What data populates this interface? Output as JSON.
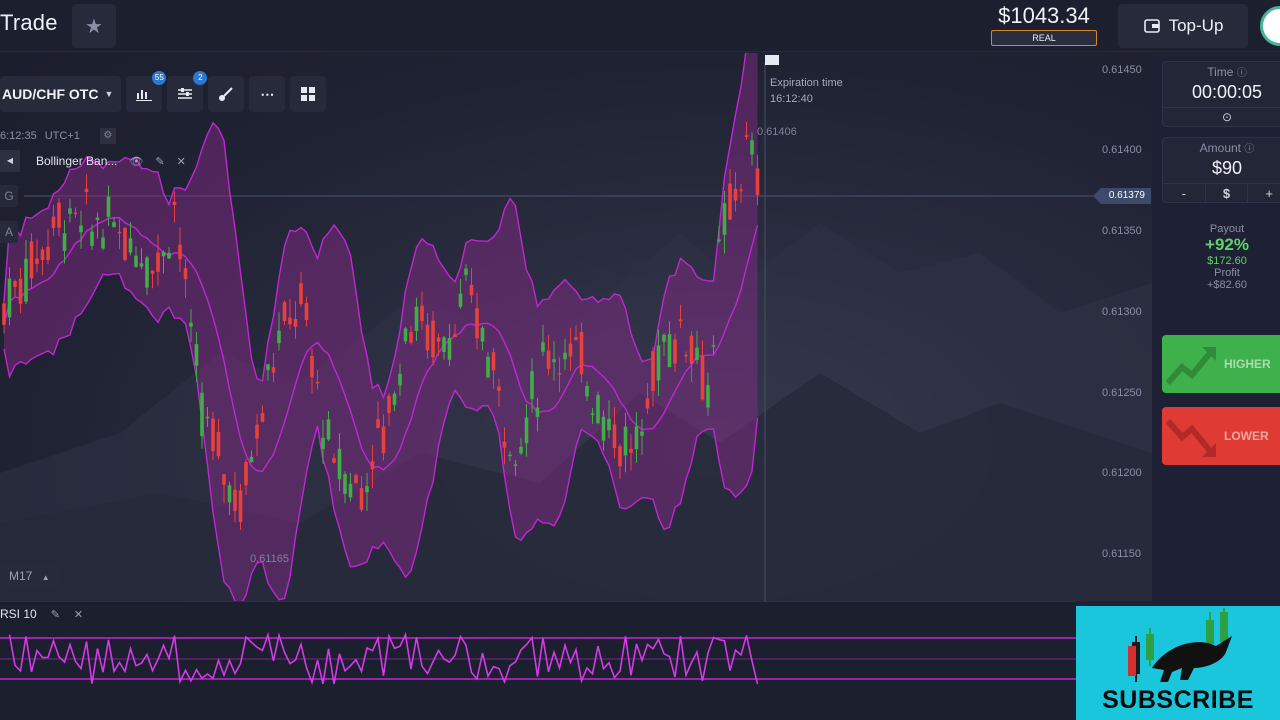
{
  "header": {
    "brand": "Trade",
    "favorite_icon": "star-icon",
    "balance": "$1043.34",
    "account_type": "REAL",
    "topup_label": "Top-Up",
    "topup_icon": "wallet-icon"
  },
  "chart": {
    "asset": "AUD/CHF OTC",
    "tool_badges": {
      "indicators": "55",
      "settings": "2"
    },
    "server_time": "6:12:35",
    "timezone": "UTC+1",
    "indicator_name": "Bollinger Ban...",
    "side_letters": [
      "G",
      "A"
    ],
    "expiration_label": "Expiration time",
    "expiration_time": "16:12:40",
    "high_label": "0.61406",
    "low_label": "0.61165",
    "current_price": "0.61379",
    "timeframe": "M17",
    "price_axis": [
      "0.61450",
      "0.61400",
      "0.61350",
      "0.61300",
      "0.61250",
      "0.61200",
      "0.61150"
    ],
    "colors": {
      "up": "#3fae44",
      "down": "#e8413b",
      "band": "#c026d3",
      "band_fill": "#8b2a8f"
    }
  },
  "panel": {
    "time_label": "Time",
    "time_value": "00:00:05",
    "amount_label": "Amount",
    "amount_value": "$90",
    "amount_minus": "-",
    "amount_currency": "$",
    "amount_plus": "+",
    "payout_label": "Payout",
    "payout_pct": "+92%",
    "payout_amount": "$172.60",
    "profit_label": "Profit",
    "profit_amount": "+$82.60",
    "higher_label": "HIGHER",
    "lower_label": "LOWER",
    "colors": {
      "higher": "#3fb14c",
      "lower": "#e03a35"
    }
  },
  "rsi": {
    "label": "RSI 10"
  },
  "ad": {
    "subscribe_text": "SUBSCRIBE"
  }
}
